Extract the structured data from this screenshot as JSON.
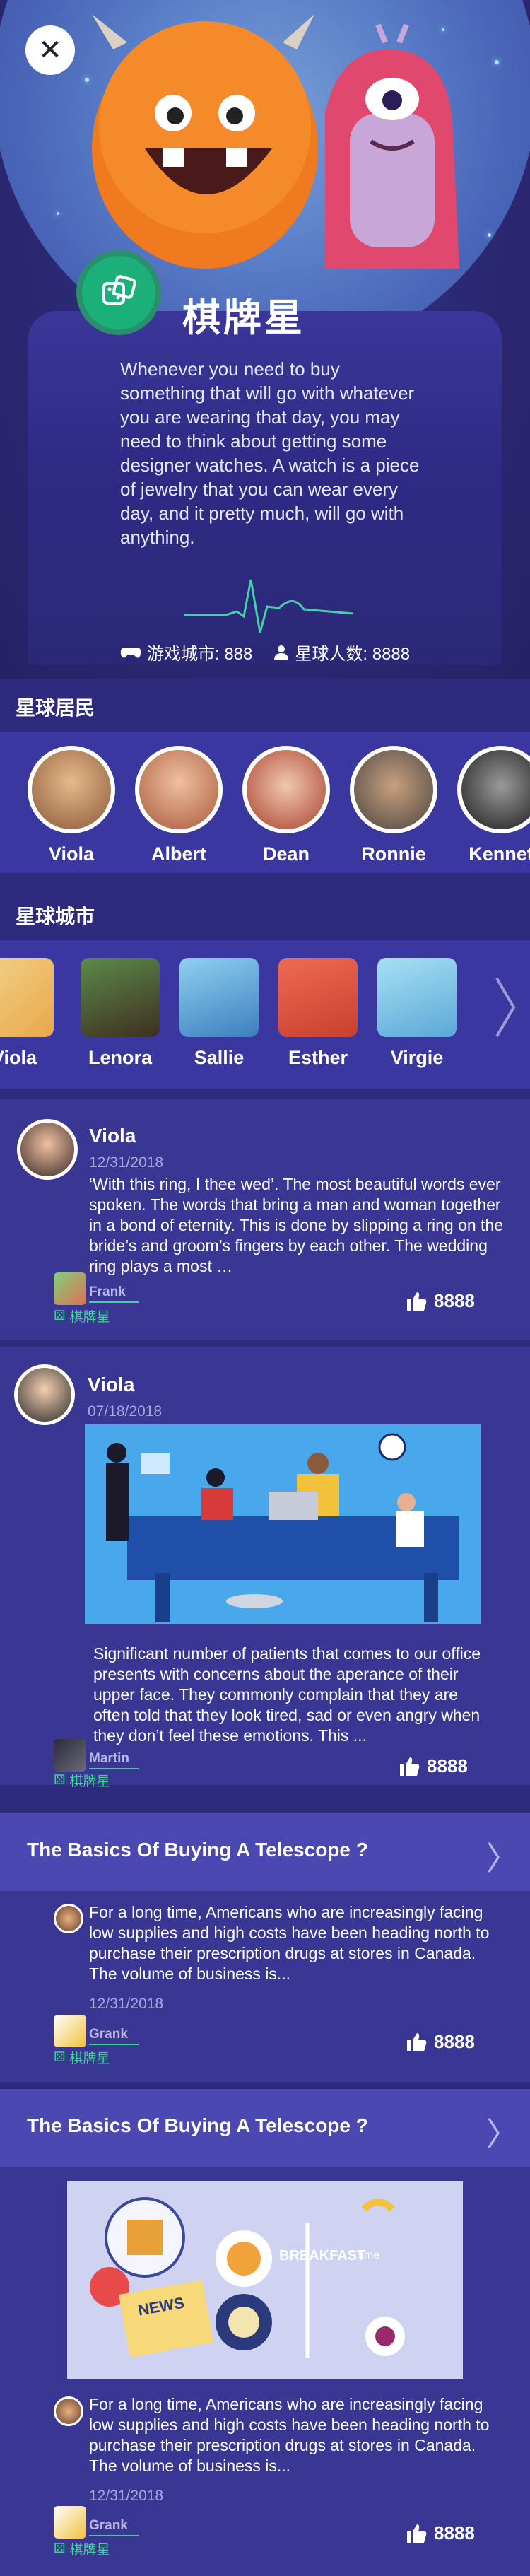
{
  "header": {
    "close_label": "✕"
  },
  "game": {
    "title": "棋牌星",
    "description": "Whenever you need to buy something that will go with whatever you are wearing that day, you may need to think about getting some designer watches. A watch is a piece of jewelry that you can wear every day, and it pretty much, will go with anything.",
    "stats": {
      "cities": "游戏城市: 888",
      "population": "星球人数: 8888"
    }
  },
  "residents": {
    "title": "星球居民",
    "items": [
      {
        "name": "Viola",
        "color": "#c9945e"
      },
      {
        "name": "Albert",
        "color": "#d28c6a"
      },
      {
        "name": "Dean",
        "color": "#b3543f"
      },
      {
        "name": "Ronnie",
        "color": "#6f6a63"
      },
      {
        "name": "Kennet",
        "color": "#3a3a3a"
      }
    ]
  },
  "cities": {
    "title": "星球城市",
    "items": [
      {
        "name": "Viola",
        "color": "#e9b35a"
      },
      {
        "name": "Lenora",
        "color": "#4c4030"
      },
      {
        "name": "Sallie",
        "color": "#5aa7d6"
      },
      {
        "name": "Esther",
        "color": "#e35c4a"
      },
      {
        "name": "Virgie",
        "color": "#7fc6e8"
      }
    ]
  },
  "posts": [
    {
      "user": "Viola",
      "date": "12/31/2018",
      "text": "‘With this ring, I thee wed’. The most beautiful words ever spoken. The words that bring a man and woman together in a bond of eternity. This is done by slipping a ring on the bride’s and groom’s fingers by each other.  The wedding ring plays a most …",
      "author": "Frank",
      "tag": "棋牌星",
      "likes": "8888"
    },
    {
      "user": "Viola",
      "date": "07/18/2018",
      "text": "Significant number of patients that comes to our office presents with concerns about the aperance of their upper face. They commonly complain that they are often told that they look tired, sad or even angry when they don’t feel these emotions. This ...",
      "author": "Martin",
      "tag": "棋牌星",
      "likes": "8888"
    },
    {
      "title": "The Basics Of Buying A Telescope ?",
      "text": "For a long time, Americans who are increasingly facing low supplies and high costs have been heading north to purchase their prescription drugs at stores in Canada. The volume of business is...",
      "date": "12/31/2018",
      "author": "Grank",
      "tag": "棋牌星",
      "likes": "8888"
    },
    {
      "title": "The Basics Of Buying A Telescope ?",
      "image_text": "BREAKFAST",
      "image_sub": "time",
      "news": "NEWS",
      "text": "For a long time, Americans who are increasingly facing low supplies and high costs have been heading north to purchase their prescription drugs at stores in Canada. The volume of business is...",
      "date": "12/31/2018",
      "author": "Grank",
      "tag": "棋牌星",
      "likes": "8888"
    }
  ]
}
